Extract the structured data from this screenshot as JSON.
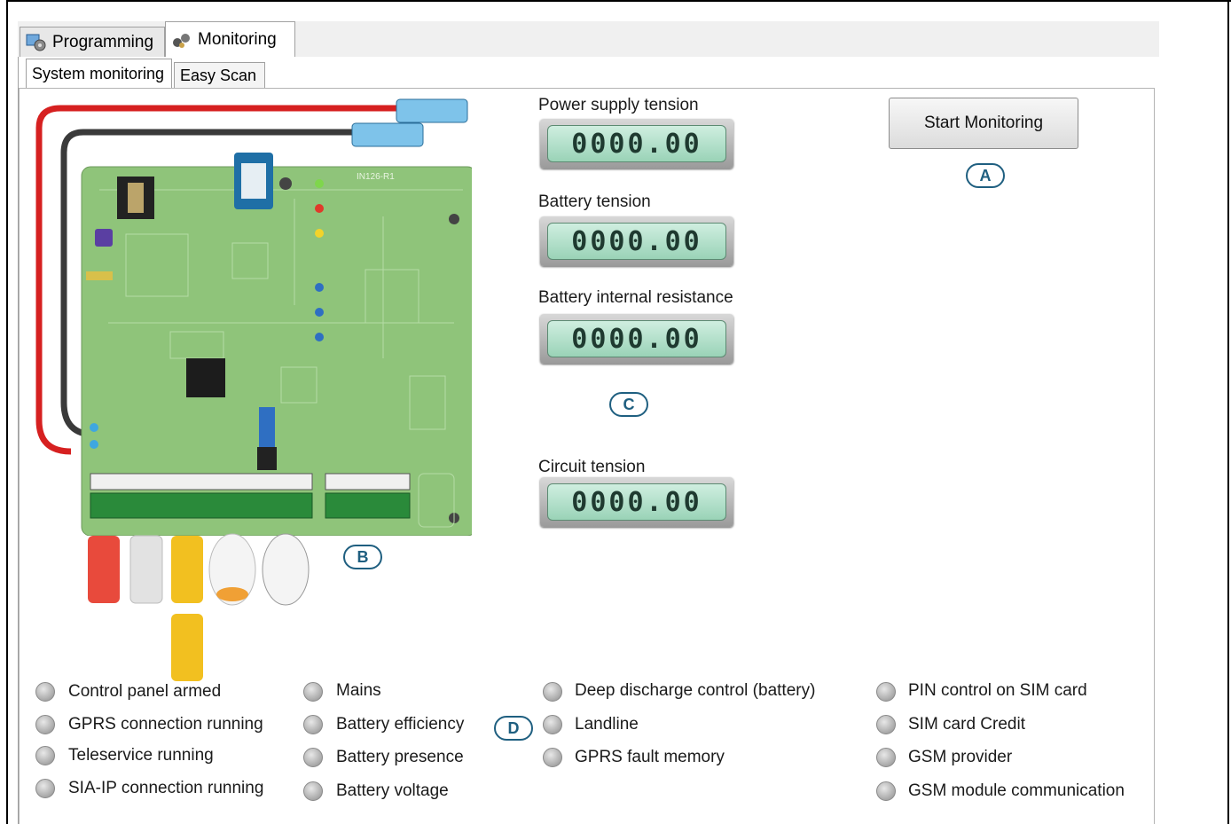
{
  "tabs": {
    "programming_label": "Programming",
    "monitoring_label": "Monitoring"
  },
  "subtabs": {
    "system_monitoring_label": "System monitoring",
    "easy_scan_label": "Easy Scan"
  },
  "board": {
    "silkscreen_label": "IN126-R1"
  },
  "readouts": {
    "power_supply": {
      "label": "Power supply tension",
      "value": "0000.00"
    },
    "battery_tension": {
      "label": "Battery tension",
      "value": "0000.00"
    },
    "battery_resistance": {
      "label": "Battery internal resistance",
      "value": "0000.00"
    },
    "circuit_tension": {
      "label": "Circuit tension",
      "value": "0000.00"
    }
  },
  "start_button": {
    "label": "Start Monitoring"
  },
  "callouts": {
    "a": "A",
    "b": "B",
    "c": "C",
    "d": "D"
  },
  "status_columns": [
    [
      "Control panel armed",
      "GPRS connection running",
      "Teleservice running",
      "SIA-IP connection running"
    ],
    [
      "Mains",
      "Battery efficiency",
      "Battery presence",
      "Battery voltage"
    ],
    [
      "Deep discharge control (battery)",
      "Landline",
      "GPRS fault memory"
    ],
    [
      "PIN control on SIM card",
      "SIM card Credit",
      "GSM provider",
      "GSM module communication"
    ]
  ],
  "colors": {
    "accent_callout": "#1f5f80",
    "lcd_bg": "#b5e2cb",
    "pcb_green": "#8fc47a",
    "wire_red": "#d62020",
    "wire_black": "#3a3a3a"
  }
}
